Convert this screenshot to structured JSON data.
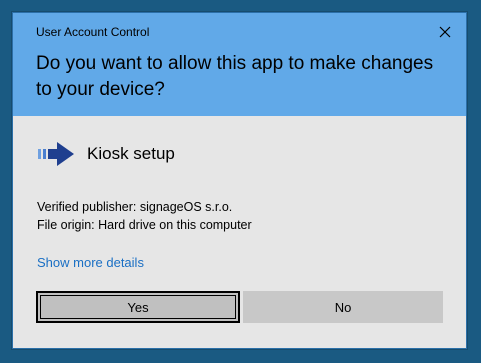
{
  "dialog": {
    "caption": "User Account Control",
    "question": "Do you want to allow this app to make changes to your device?",
    "app_name": "Kiosk setup",
    "publisher": "Verified publisher: signageOS s.r.o.",
    "origin": "File origin: Hard drive on this computer",
    "more_details": "Show more details",
    "yes_label": "Yes",
    "no_label": "No",
    "icons": {
      "close": "close-icon",
      "app": "arrow-right-icon"
    },
    "colors": {
      "header": "#61a9e8",
      "body": "#e6e6e6",
      "link": "#1a6fc4",
      "icon": "#1f3f8f"
    }
  }
}
